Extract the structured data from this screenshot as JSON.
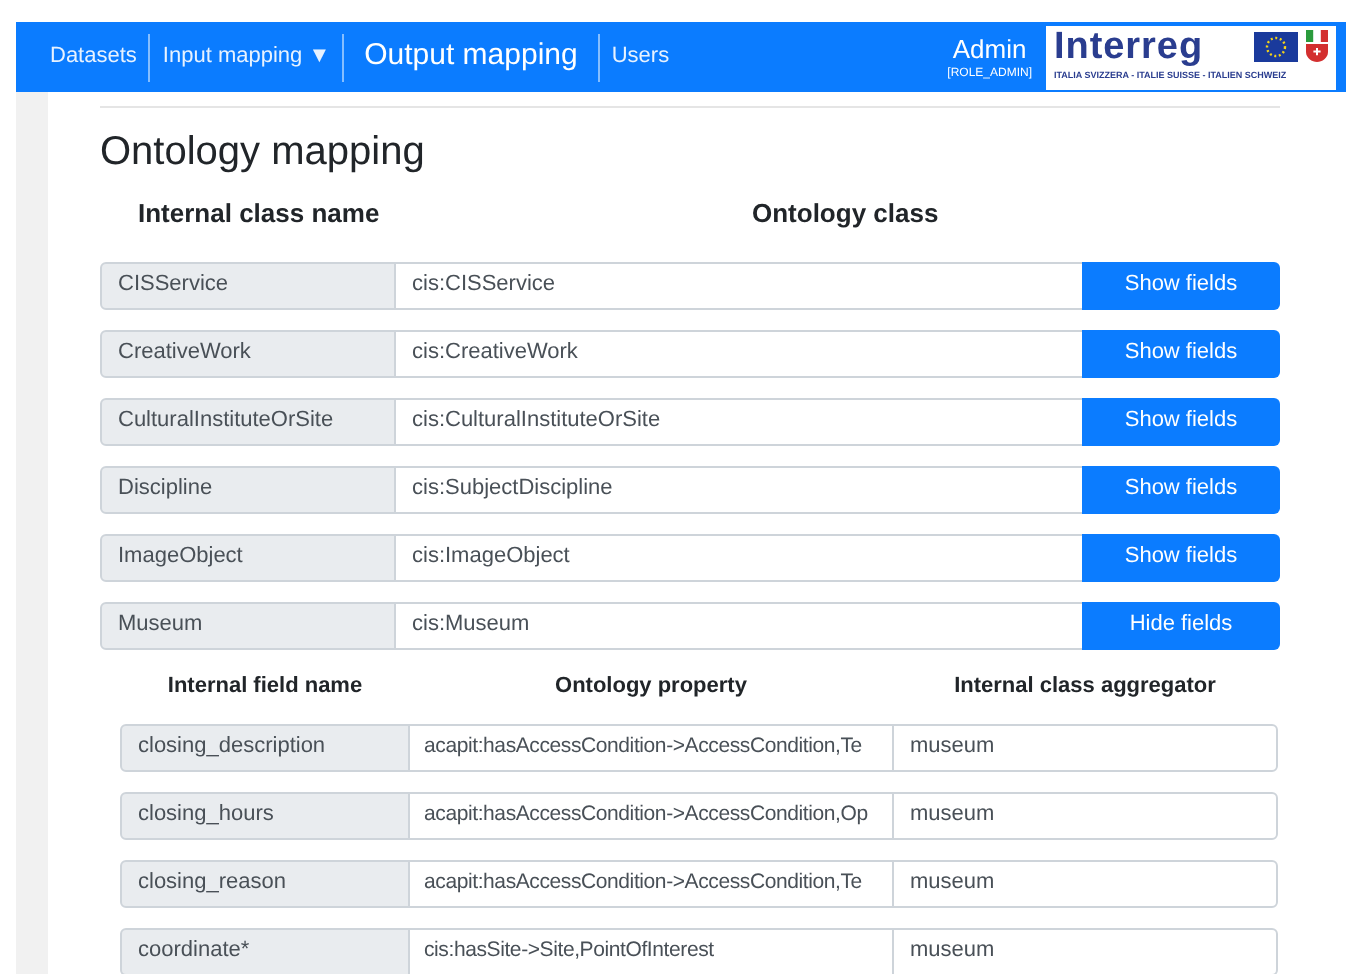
{
  "navbar": {
    "items": [
      {
        "label": "Datasets",
        "selected": false
      },
      {
        "label": "Input mapping",
        "selected": false,
        "caret": "▼"
      },
      {
        "label": "Output mapping",
        "selected": true
      },
      {
        "label": "Users",
        "selected": false
      }
    ],
    "user": {
      "name": "Admin",
      "role": "[ROLE_ADMIN]"
    },
    "logo": {
      "title": "Interreg",
      "subtitle": "ITALIA SVIZZERA - ITALIE SUISSE - ITALIEN SCHWEIZ"
    }
  },
  "heading": "Ontology mapping",
  "class_columns": [
    "Internal class name",
    "Ontology class"
  ],
  "classes": [
    {
      "name": "CISService",
      "ontology_class": "cis:CISService",
      "button": "Show fields"
    },
    {
      "name": "CreativeWork",
      "ontology_class": "cis:CreativeWork",
      "button": "Show fields"
    },
    {
      "name": "CulturalInstituteOrSite",
      "ontology_class": "cis:CulturalInstituteOrSite",
      "button": "Show fields"
    },
    {
      "name": "Discipline",
      "ontology_class": "cis:SubjectDiscipline",
      "button": "Show fields"
    },
    {
      "name": "ImageObject",
      "ontology_class": "cis:ImageObject",
      "button": "Show fields"
    },
    {
      "name": "Museum",
      "ontology_class": "cis:Museum",
      "button": "Hide fields",
      "field_columns": [
        "Internal field name",
        "Ontology property",
        "Internal class aggregator"
      ],
      "fields": [
        {
          "name": "closing_description",
          "property": "acapit:hasAccessCondition->AccessCondition,Te",
          "aggregator": "museum"
        },
        {
          "name": "closing_hours",
          "property": "acapit:hasAccessCondition->AccessCondition,Op",
          "aggregator": "museum"
        },
        {
          "name": "closing_reason",
          "property": "acapit:hasAccessCondition->AccessCondition,Te",
          "aggregator": "museum"
        },
        {
          "name": "coordinate*",
          "property": "cis:hasSite->Site,PointOfInterest",
          "aggregator": "museum"
        }
      ]
    }
  ]
}
